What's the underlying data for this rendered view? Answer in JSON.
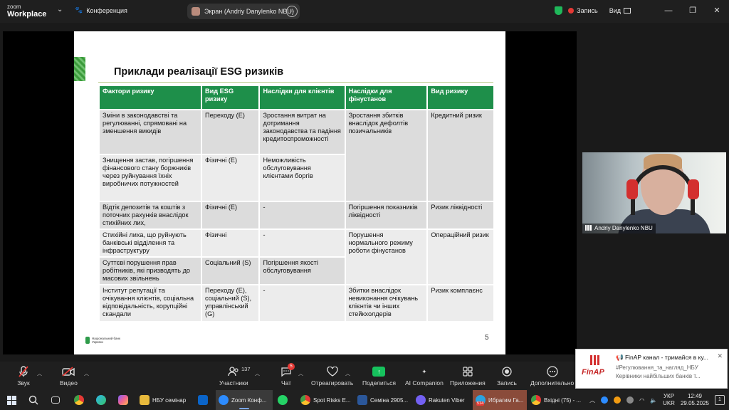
{
  "topbar": {
    "logo_line1": "zoom",
    "logo_line2": "Workplace",
    "conference_label": "Конференция",
    "screen_share_label": "Экран (Andriy Danylenko NBU)",
    "more_label": "···",
    "recording_label": "Запись",
    "view_label": "Вид",
    "minimize_label": "—",
    "restore_label": "❐",
    "close_label": "✕"
  },
  "slide": {
    "title": "Приклади реалізації ESG ризиків",
    "headers": [
      "Фактори ризику",
      "Вид ESG ризику",
      "Наслідки для клієнтів",
      "Наслідки для фінустанов",
      "Вид ризику"
    ],
    "rows": [
      [
        "Зміни в законодавстві та регулюванні, спрямовані на зменшення викидів",
        "Переходу (E)",
        "Зростання витрат на дотримання законодавства та падіння кредитоспроможності",
        "Зростання збитків внаслідок дефолтів позичальників",
        "Кредитний ризик"
      ],
      [
        "Знищення застав, погіршення фінансового стану боржників через руйнування їхніх виробничих потужностей",
        "Фізичні (E)",
        "Неможливість обслуговування клієнтами боргів",
        "",
        ""
      ],
      [
        "Відтік депозитів та коштів з поточних рахунків внаслідок стихійних лих,",
        "Фізичні (E)",
        "-",
        "Погіршення показників ліквідності",
        "Ризик ліквідності"
      ],
      [
        "Стихійні лиха, що руйнують банківські відділення та інфраструктуру",
        "Фізичні",
        "-",
        "Порушення нормального режиму роботи фінустанов",
        "Операційний ризик"
      ],
      [
        "Суттєві порушення прав робітників, які призводять до масових звільнень",
        "Соціальний (S)",
        "Погіршення якості обслуговування",
        "",
        ""
      ],
      [
        "Інститут репутації та очікування клієнтів, соціальна відповідальність, корупційні скандали",
        "Переходу (E), соціальний (S), управлінський (G)",
        "-",
        "Збитки внаслідок невиконання очікувань клієнтів чи інших стейкхолдерів",
        "Ризик комплаєнс"
      ]
    ],
    "footer_logo": "Національний банк України",
    "page_number": "5"
  },
  "video": {
    "participant_name": "Andriy Danylenko NBU"
  },
  "controls": {
    "audio": "Звук",
    "video": "Видео",
    "participants": "Участники",
    "participants_count": "137",
    "chat": "Чат",
    "chat_badge": "5",
    "react": "Отреагировать",
    "share": "Поделиться",
    "ai": "AI Companion",
    "apps": "Приложения",
    "record": "Запись",
    "more": "Дополнительно"
  },
  "notification": {
    "title": "📢 FinAP канал - тримайся в ку...",
    "line1": "#Регулювання_та_нагляд_НБУ",
    "line2": "Керівники найбільших банків т...",
    "logo_text": "FinAP"
  },
  "taskbar": {
    "items": [
      {
        "label": "НБУ семінар",
        "color": "#e7b93c"
      },
      {
        "label": "Zoom Конф...",
        "color": "#2d8cff"
      },
      {
        "label": "Spot Risks E...",
        "color": "#4caf50"
      },
      {
        "label": "Семіна 2905...",
        "color": "#2b579a"
      },
      {
        "label": "Rakuten Viber",
        "color": "#7360f2"
      },
      {
        "label": "Ибрагим Га...",
        "color": "#2aa3e0"
      },
      {
        "label": "Вхідні (75) - ...",
        "color": "#e53935"
      }
    ],
    "tg_badge": "514",
    "lang_top": "УКР",
    "lang_bottom": "UKR",
    "time": "12:49",
    "date": "29.05.2025",
    "notif_count": "1"
  },
  "colors": {
    "table_header": "#1e8f4a",
    "cell_dark": "#dcdcdc",
    "cell_light": "#ececec",
    "rec_dot": "#e53935",
    "share_green": "#16c25d"
  }
}
